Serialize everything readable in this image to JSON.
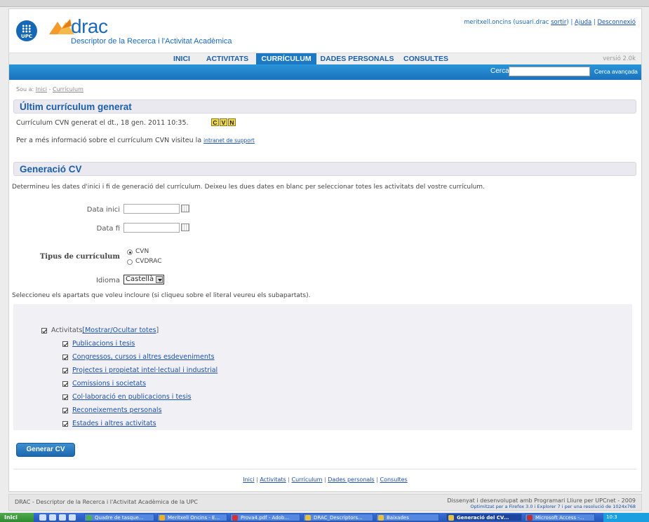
{
  "header": {
    "logo_upc": "UPC",
    "app_name": "drac",
    "subtitle": "Descriptor de la Recerca i l'Activitat Acadèmica",
    "user": "meritxell.oncins (usuari.drac",
    "sortir": "sortir",
    "user_close": ")",
    "ajuda": "Ajuda",
    "desconnexio": "Desconnexió",
    "separator": "|"
  },
  "nav": {
    "tabs": [
      "INICI",
      "ACTIVITATS",
      "CURRÍCULUM",
      "DADES PERSONALS",
      "CONSULTES"
    ],
    "active_tab": "CURRÍCULUM",
    "version": "versió 2.0k"
  },
  "search": {
    "label": "Cercar",
    "value": "",
    "advanced": "Cerca avançada"
  },
  "breadcrumb": {
    "prefix": "Sou a:",
    "items": [
      "Inici",
      "Currículum"
    ],
    "separator": "-"
  },
  "last_cv": {
    "title": "Últim currículum generat",
    "generated_text": "Currículum CVN generat el dt., 18 gen. 2011 10:35.",
    "icons": [
      "C",
      "V",
      "N"
    ],
    "info_text": "Per a més informació sobre el currículum CVN visiteu la",
    "info_link": "intranet de support"
  },
  "generation": {
    "title": "Generació CV",
    "instructions": "Determineu les dates d'inici i fi de generació del currículum. Deixeu les dues dates en blanc per seleccionar totes les activitats del vostre currículum.",
    "start_date_label": "Data inici",
    "start_date_value": "",
    "end_date_label": "Data fi",
    "end_date_value": "",
    "cv_type_label": "Tipus de currículum",
    "cv_types": [
      "CVN",
      "CVDRAC"
    ],
    "cv_type_selected": "CVN",
    "language_label": "Idioma",
    "language_value": "Castellà",
    "sections_instructions": "Seleccioneu els apartats que voleu incloure (si cliqueu sobre el literal veureu els subapartats).",
    "activities_label": "Activitats",
    "show_hide_all": "[Mostrar/Ocultar totes",
    "show_hide_close": "]",
    "sections": [
      "Publicacions i tesis",
      "Congressos, cursos i altres esdeveniments",
      "Projectes i propietat intel·lectual i industrial",
      "Comissions i societats",
      "Col·laboració en publicacions i tesis",
      "Reconeixements personals",
      "Estades i altres activitats"
    ],
    "generate_button": "Generar CV"
  },
  "footer": {
    "links": [
      "Inici",
      "Activitats",
      "Currículum",
      "Dades personals",
      "Consultes"
    ],
    "separator": "|",
    "left_text": "DRAC - Descriptor de la Recerca i l'Activitat Acadèmica de la UPC",
    "right_text": "Dissenyat i desenvolupat amb Programari Lliure per UPCnet - 2009",
    "optimized_text": "Optimitzat per a Firefox 3.0 i Explorer 7 i per una resolució de 1024x768"
  },
  "taskbar": {
    "start": "Inici",
    "tasks": [
      "Quadre de tasque...",
      "Meritxell Oncins - E...",
      "Prova4.pdf - Adob...",
      "DRAC_Descriptors...",
      "Baixades",
      "Generació del CV...",
      "Microsoft Access -..."
    ],
    "active_task": "Generació del CV...",
    "clock": "10:3"
  },
  "colors": {
    "brand_blue": "#1b79c5",
    "link_blue": "#1b4fa8",
    "section_bg": "#e9e9ef"
  }
}
